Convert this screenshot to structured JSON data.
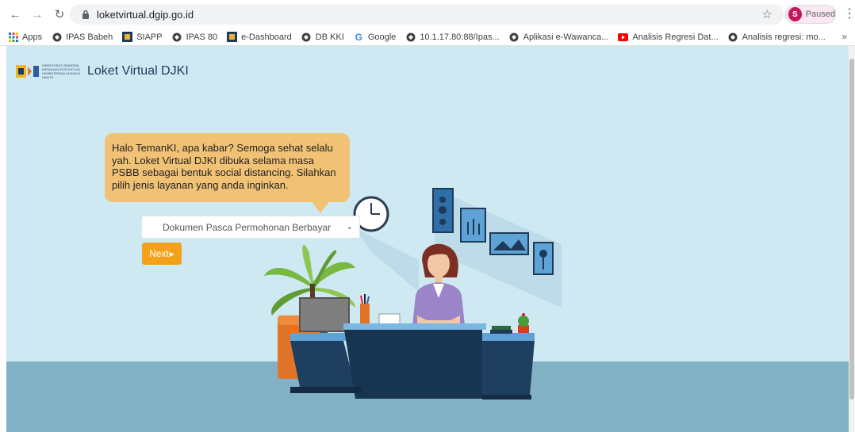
{
  "browser": {
    "url": "loketvirtual.dgip.go.id",
    "profile_initial": "S",
    "profile_status": "Paused"
  },
  "bookmarks": [
    {
      "label": "Apps",
      "icon": "apps-grid-icon"
    },
    {
      "label": "IPAS Babeh",
      "icon": "globe-icon"
    },
    {
      "label": "SIAPP",
      "icon": "site-logo-icon"
    },
    {
      "label": "IPAS 80",
      "icon": "globe-icon"
    },
    {
      "label": "e-Dashboard",
      "icon": "site-logo-icon"
    },
    {
      "label": "DB KKI",
      "icon": "globe-icon"
    },
    {
      "label": "Google",
      "icon": "google-icon"
    },
    {
      "label": "10.1.17.80:88/Ipas...",
      "icon": "globe-icon"
    },
    {
      "label": "Aplikasi e-Wawanca...",
      "icon": "globe-icon"
    },
    {
      "label": "Analisis Regresi Dat...",
      "icon": "youtube-icon"
    },
    {
      "label": "Analisis regresi: mo...",
      "icon": "globe-icon"
    }
  ],
  "header": {
    "logo_text": "DIREKTORAT JENDERAL KEKAYAAN INTELEKTUAL KEMENTERIAN HUKUM & HAM RI",
    "title": "Loket Virtual DJKI"
  },
  "main": {
    "greeting": "Halo TemanKI, apa kabar? Semoga sehat selalu yah. Loket Virtual DJKI dibuka selama masa PSBB sebagai bentuk social distancing. Silahkan pilih jenis layanan yang anda inginkan.",
    "service_select": "Dokumen Pasca Permohonan Berbayar",
    "next_label": "Next"
  },
  "colors": {
    "background": "#cfe9f3",
    "floor": "#82b1c5",
    "bubble": "#f1c276",
    "button": "#f4a11a",
    "desk": "#1e3f5f"
  }
}
